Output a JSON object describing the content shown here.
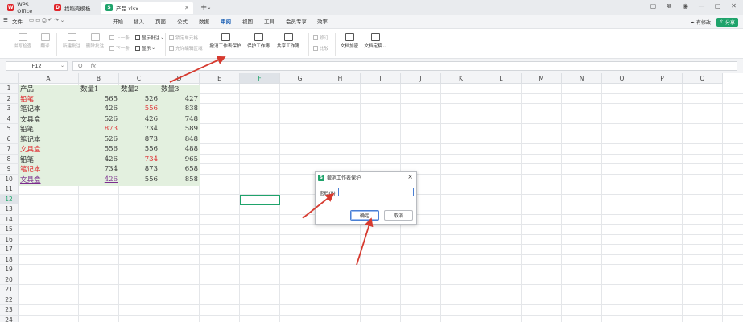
{
  "tabs": [
    {
      "label": "WPS Office",
      "icon": "wps-logo-icon",
      "color": "#e0262b"
    },
    {
      "label": "找稻壳模板",
      "icon": "docer-logo-icon",
      "color": "#e0262b"
    },
    {
      "label": "产品.xlsx",
      "icon": "sheet-logo-icon",
      "color": "#1fa36b"
    }
  ],
  "menu": {
    "file": "文件",
    "items": [
      "开始",
      "插入",
      "页面",
      "公式",
      "数据",
      "审阅",
      "视图",
      "工具",
      "会员专享",
      "效率"
    ],
    "active": "审阅",
    "right_label": "有修改",
    "share_label": "分享"
  },
  "ribbon": {
    "spell": "拼写检查",
    "translate": "翻译",
    "new_comment": "新建批注",
    "delete_comment": "删除批注",
    "prev": "上一条",
    "next": "下一条",
    "show_all": "显示批注",
    "show": "显示",
    "lock_cell": "锁定单元格",
    "allow_edit": "允许编辑区域",
    "unprotect_sheet": "撤消工作表保护",
    "protect_book": "保护工作簿",
    "share_book": "共享工作簿",
    "track": "修订",
    "compare": "比较",
    "doc_encrypt": "文档加密",
    "doc_finalize": "文档定稿"
  },
  "formula_bar": {
    "cell_ref": "F12",
    "fx": "fx",
    "zoom": "Q"
  },
  "columns": [
    "A",
    "B",
    "C",
    "D",
    "E",
    "F",
    "G",
    "H",
    "I",
    "J",
    "K",
    "L",
    "M",
    "N",
    "O",
    "P",
    "Q"
  ],
  "selected_col": "F",
  "rows": [
    "1",
    "2",
    "3",
    "4",
    "5",
    "6",
    "7",
    "8",
    "9",
    "10",
    "11",
    "12",
    "13",
    "14",
    "15",
    "16",
    "17",
    "18",
    "19",
    "20",
    "21",
    "22",
    "23",
    "24"
  ],
  "selected_row": "12",
  "headers": [
    "产品",
    "数量1",
    "数量2",
    "数量3"
  ],
  "data": [
    {
      "name": "铅笔",
      "q1": "565",
      "q2": "526",
      "q3": "427"
    },
    {
      "name": "笔记本",
      "q1": "426",
      "q2": "556",
      "q3": "838"
    },
    {
      "name": "文具盒",
      "q1": "526",
      "q2": "426",
      "q3": "748"
    },
    {
      "name": "铅笔",
      "q1": "873",
      "q2": "734",
      "q3": "589"
    },
    {
      "name": "笔记本",
      "q1": "526",
      "q2": "873",
      "q3": "848"
    },
    {
      "name": "文具盒",
      "q1": "556",
      "q2": "556",
      "q3": "488"
    },
    {
      "name": "铅笔",
      "q1": "426",
      "q2": "734",
      "q3": "965"
    },
    {
      "name": "笔记本",
      "q1": "734",
      "q2": "873",
      "q3": "658"
    },
    {
      "name": "文具盒",
      "q1": "426",
      "q2": "556",
      "q3": "858"
    }
  ],
  "colors": {
    "accent": "#1fa36b",
    "red_text": "#e0262b",
    "purple_text": "#7b2d8e",
    "shade": "#e3f0df",
    "arrow": "#d63a2f"
  },
  "dialog": {
    "title": "撤消工作表保护",
    "password_label": "密码(P):",
    "password_value": "",
    "ok": "确定",
    "cancel": "取消"
  }
}
